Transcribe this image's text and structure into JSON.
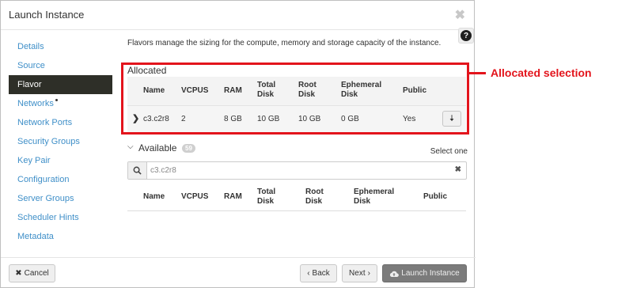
{
  "window": {
    "title": "Launch Instance",
    "close_glyph": "✖"
  },
  "help": {
    "glyph": "?"
  },
  "sidebar": {
    "items": [
      {
        "label": "Details"
      },
      {
        "label": "Source"
      },
      {
        "label": "Flavor",
        "active": true
      },
      {
        "label": "Networks",
        "required_dot": true
      },
      {
        "label": "Network Ports"
      },
      {
        "label": "Security Groups"
      },
      {
        "label": "Key Pair"
      },
      {
        "label": "Configuration"
      },
      {
        "label": "Server Groups"
      },
      {
        "label": "Scheduler Hints"
      },
      {
        "label": "Metadata"
      }
    ]
  },
  "description": "Flavors manage the sizing for the compute, memory and storage capacity of the instance.",
  "allocated": {
    "label": "Allocated",
    "columns": {
      "name": "Name",
      "vcpus": "VCPUS",
      "ram": "RAM",
      "total_disk": [
        "Total",
        "Disk"
      ],
      "root_disk": [
        "Root",
        "Disk"
      ],
      "ephemeral_disk": [
        "Ephemeral",
        "Disk"
      ],
      "public": "Public"
    },
    "row": {
      "name": "c3.c2r8",
      "vcpus": "2",
      "ram": "8 GB",
      "total_disk": "10 GB",
      "root_disk": "10 GB",
      "ephemeral_disk": "0 GB",
      "public": "Yes"
    }
  },
  "annotation": {
    "text": "Allocated selection",
    "color": "#e3141c"
  },
  "available": {
    "label": "Available",
    "count": "59",
    "select_hint": "Select one",
    "search_value": "c3.c2r8",
    "columns": {
      "name": "Name",
      "vcpus": "VCPUS",
      "ram": "RAM",
      "total_disk": [
        "Total",
        "Disk"
      ],
      "root_disk": [
        "Root",
        "Disk"
      ],
      "ephemeral_disk": [
        "Ephemeral",
        "Disk"
      ],
      "public": "Public"
    }
  },
  "footer": {
    "cancel_label": "Cancel",
    "back_label": "Back",
    "next_label": "Next",
    "launch_label": "Launch Instance"
  },
  "icons": {
    "cancel": "times-icon",
    "back": "chevron-left-icon",
    "next": "chevron-right-icon",
    "launch": "cloud-upload-icon",
    "search": "search-icon",
    "clear": "times-icon",
    "expand": "chevron-right-icon",
    "deallocate": "arrow-down-icon"
  }
}
